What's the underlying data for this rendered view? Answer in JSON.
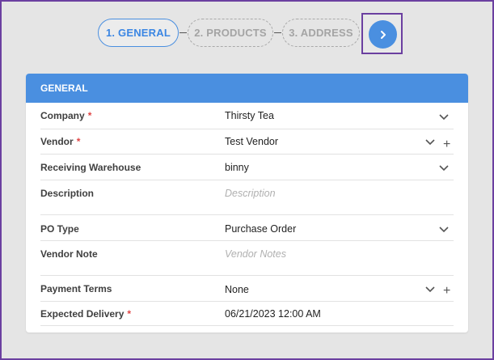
{
  "stepper": {
    "steps": [
      {
        "label": "1. GENERAL"
      },
      {
        "label": "2. PRODUCTS"
      },
      {
        "label": "3. ADDRESS"
      }
    ],
    "next_icon": "›"
  },
  "card": {
    "title": "GENERAL",
    "fields": [
      {
        "label": "Company",
        "required": "*",
        "value": "Thirsty Tea"
      },
      {
        "label": "Vendor",
        "required": "*",
        "value": "Test Vendor"
      },
      {
        "label": "Receiving Warehouse",
        "value": "binny"
      },
      {
        "label": "Description",
        "placeholder": "Description"
      },
      {
        "label": "PO Type",
        "value": "Purchase Order"
      },
      {
        "label": "Vendor Note",
        "placeholder": "Vendor Notes"
      },
      {
        "label": "Payment Terms",
        "value": "None"
      },
      {
        "label": "Expected Delivery",
        "required": "*",
        "value": "06/21/2023 12:00 AM"
      }
    ],
    "plus_icon": "+"
  },
  "colors": {
    "accent": "#4a8fe0",
    "highlight_border": "#6b3fa0",
    "required": "#e04545"
  }
}
